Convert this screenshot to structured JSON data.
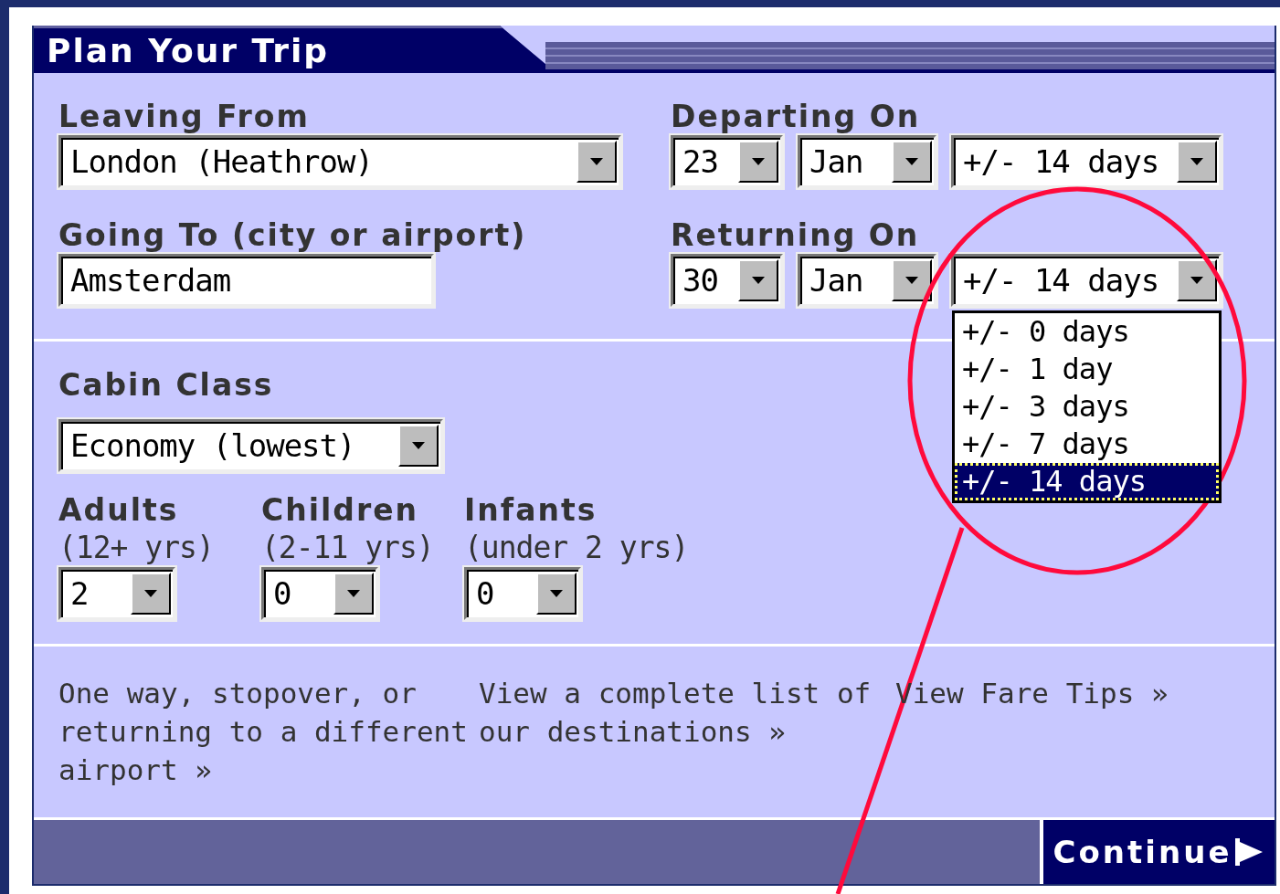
{
  "title": "Plan Your Trip",
  "leaving_from": {
    "label": "Leaving From",
    "value": "London (Heathrow)"
  },
  "going_to": {
    "label": "Going To (city or airport)",
    "value": "Amsterdam"
  },
  "departing_on": {
    "label": "Departing On",
    "day": "23",
    "month": "Jan",
    "flex": "+/- 14 days"
  },
  "returning_on": {
    "label": "Returning On",
    "day": "30",
    "month": "Jan",
    "flex": "+/- 14 days",
    "expanded": true,
    "flex_options": [
      {
        "label": "+/- 0 days",
        "selected": false
      },
      {
        "label": "+/- 1 day",
        "selected": false
      },
      {
        "label": "+/- 3 days",
        "selected": false
      },
      {
        "label": "+/- 7 days",
        "selected": false
      },
      {
        "label": "+/- 14 days",
        "selected": true
      }
    ]
  },
  "cabin_class": {
    "label": "Cabin Class",
    "value": "Economy (lowest)"
  },
  "passengers": [
    {
      "label": "Adults",
      "note": "(12+ yrs)",
      "value": "2"
    },
    {
      "label": "Children",
      "note": "(2-11 yrs)",
      "value": "0"
    },
    {
      "label": "Infants",
      "note": "(under 2 yrs)",
      "value": "0"
    }
  ],
  "links": [
    "One way, stopover, or returning to a different airport »",
    "View a complete list of our destinations »",
    "View Fare Tips »"
  ],
  "continue_button": "Continue"
}
